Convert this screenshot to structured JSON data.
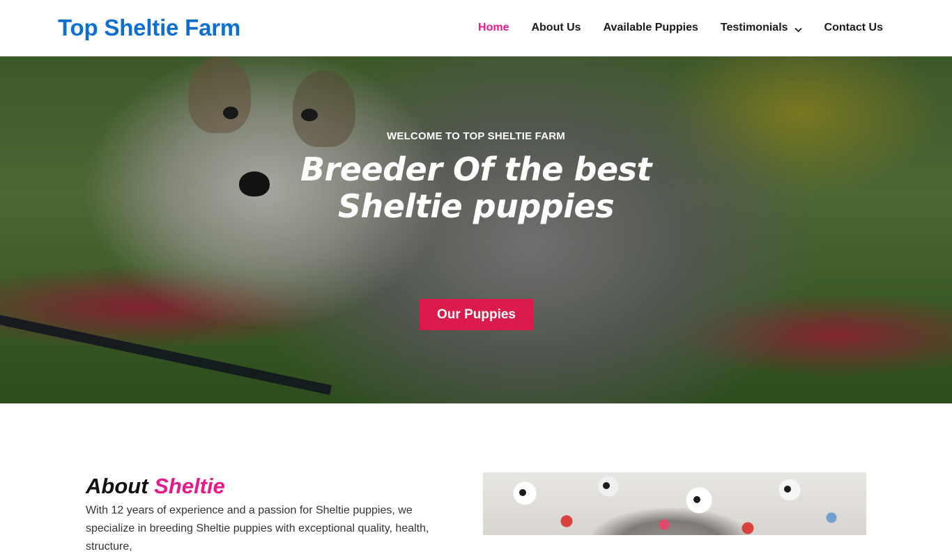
{
  "header": {
    "brand": "Top Sheltie Farm",
    "nav": [
      {
        "label": "Home",
        "active": true
      },
      {
        "label": "About Us"
      },
      {
        "label": "Available Puppies"
      },
      {
        "label": "Testimonials",
        "has_dropdown": true
      },
      {
        "label": "Contact Us"
      }
    ]
  },
  "hero": {
    "kicker": "WELCOME TO TOP SHELTIE FARM",
    "title_line1": "Breeder Of the best",
    "title_line2": "Sheltie puppies",
    "button_label": "Our Puppies"
  },
  "about": {
    "title_plain": "About",
    "title_accent": "Sheltie",
    "text": "With 12 years of experience and a passion for Sheltie puppies, we specialize in breeding Sheltie puppies with exceptional quality, health, structure,"
  },
  "colors": {
    "brand_blue": "#0e6fd2",
    "accent_pink": "#e8198b",
    "button_red": "#dc1b4d"
  },
  "icons": {
    "testimonials_dropdown": "chevron-down-icon"
  }
}
